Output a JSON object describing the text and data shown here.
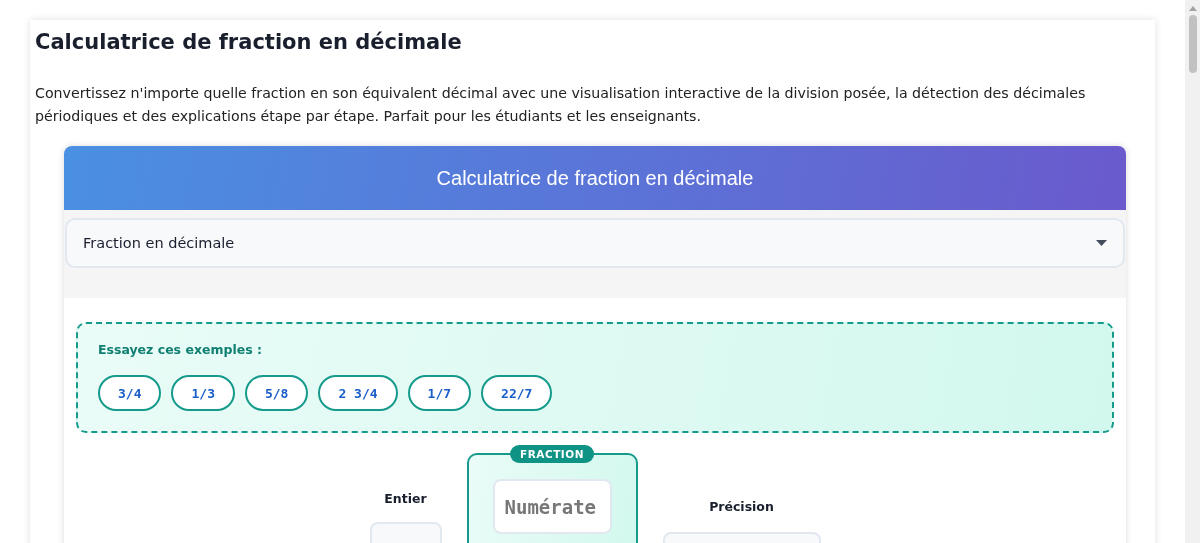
{
  "title": "Calculatrice de fraction en décimale",
  "description": "Convertissez n'importe quelle fraction en son équivalent décimal avec une visualisation interactive de la division posée, la détection des décimales périodiques et des explications étape par étape. Parfait pour les étudiants et les enseignants.",
  "calculator": {
    "header": "Calculatrice de fraction en décimale",
    "mode_select": {
      "value": "Fraction en décimale"
    },
    "examples": {
      "label": "Essayez ces exemples :",
      "items": [
        "3/4",
        "1/3",
        "5/8",
        "2 3/4",
        "1/7",
        "22/7"
      ]
    },
    "whole_field": {
      "label": "Entier"
    },
    "fraction": {
      "badge": "FRACTION",
      "numerator": {
        "placeholder": "Numérate"
      }
    },
    "precision": {
      "label": "Précision"
    }
  }
}
